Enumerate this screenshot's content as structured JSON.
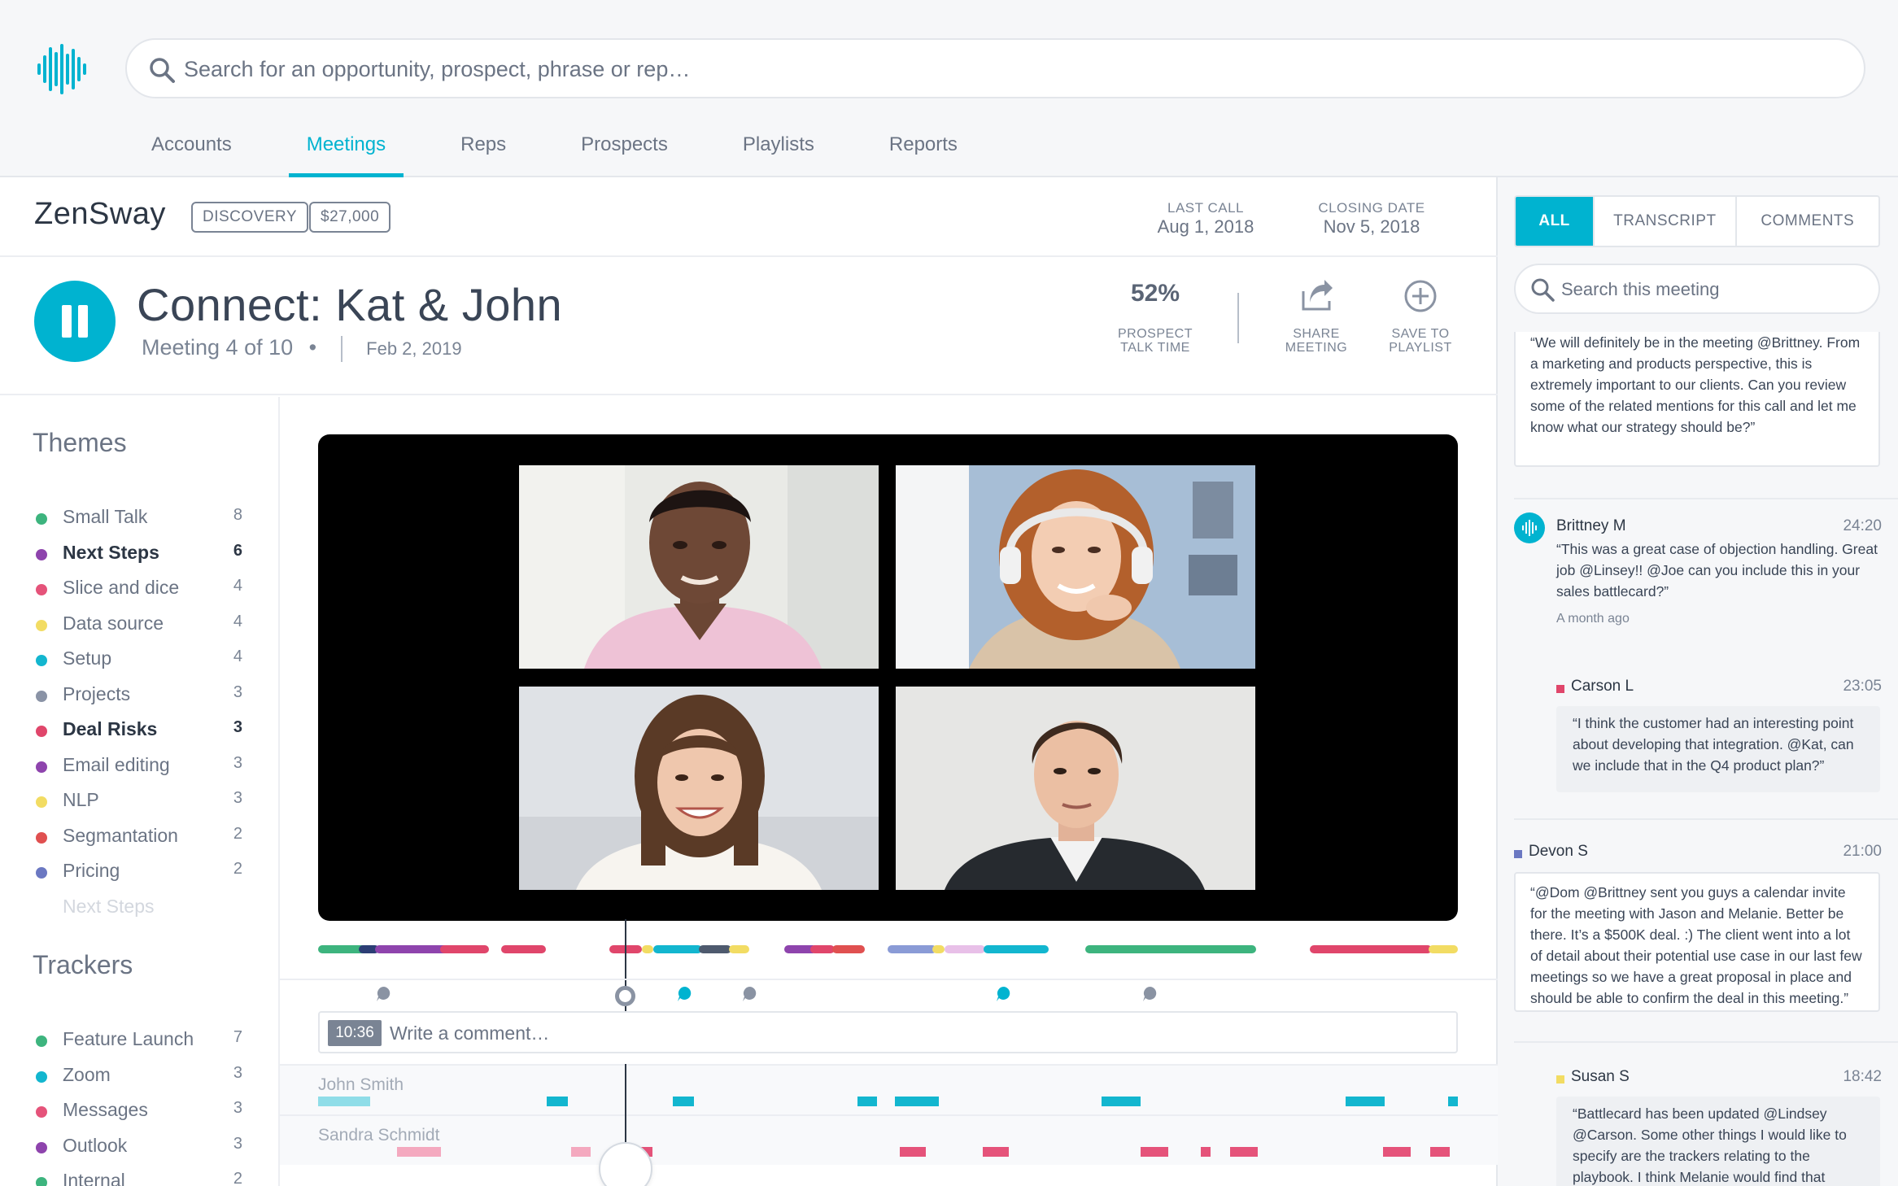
{
  "search": {
    "placeholder": "Search for an opportunity, prospect, phrase or rep…"
  },
  "nav": {
    "tabs": [
      {
        "label": "Accounts"
      },
      {
        "label": "Meetings"
      },
      {
        "label": "Reps"
      },
      {
        "label": "Prospects"
      },
      {
        "label": "Playlists"
      },
      {
        "label": "Reports"
      }
    ],
    "active": "Meetings"
  },
  "deal": {
    "company": "ZenSway",
    "stage": "DISCOVERY",
    "amount": "$27,000",
    "last_call_label": "LAST CALL",
    "last_call": "Aug 1, 2018",
    "closing_label": "CLOSING DATE",
    "closing": "Nov 5, 2018"
  },
  "meeting": {
    "title": "Connect: Kat & John",
    "index": "Meeting 4 of 10",
    "bullet": "•",
    "date": "Feb 2, 2019",
    "talk_time": "52%",
    "talk_time_label_1": "PROSPECT",
    "talk_time_label_2": "TALK TIME",
    "share_label_1": "SHARE",
    "share_label_2": "MEETING",
    "save_label_1": "SAVE TO",
    "save_label_2": "PLAYLIST"
  },
  "themes": {
    "title": "Themes",
    "items": [
      {
        "name": "Small Talk",
        "count": "8",
        "color": "#3db47e"
      },
      {
        "name": "Next Steps",
        "count": "6",
        "color": "#8e44ad"
      },
      {
        "name": "Slice and dice",
        "count": "4",
        "color": "#e5537a"
      },
      {
        "name": "Data source",
        "count": "4",
        "color": "#f2dc63"
      },
      {
        "name": "Setup",
        "count": "4",
        "color": "#13b6cf"
      },
      {
        "name": "Projects",
        "count": "3",
        "color": "#8a93a6"
      },
      {
        "name": "Deal Risks",
        "count": "3",
        "color": "#e0466b"
      },
      {
        "name": "Email editing",
        "count": "3",
        "color": "#8e44ad"
      },
      {
        "name": "NLP",
        "count": "3",
        "color": "#f2dc63"
      },
      {
        "name": "Segmantation",
        "count": "2",
        "color": "#e05050"
      },
      {
        "name": "Pricing",
        "count": "2",
        "color": "#6b78c2"
      },
      {
        "name": "Next Steps",
        "count": "",
        "color": "#e3e6eb"
      }
    ]
  },
  "trackers": {
    "title": "Trackers",
    "items": [
      {
        "name": "Feature Launch",
        "count": "7",
        "color": "#3db47e"
      },
      {
        "name": "Zoom",
        "count": "3",
        "color": "#13b6cf"
      },
      {
        "name": "Messages",
        "count": "3",
        "color": "#e5537a"
      },
      {
        "name": "Outlook",
        "count": "3",
        "color": "#8e44ad"
      },
      {
        "name": "Internal",
        "count": "2",
        "color": "#3db47e"
      }
    ]
  },
  "comment": {
    "time": "10:36",
    "placeholder": "Write a comment…"
  },
  "speakers": [
    {
      "name": "John Smith",
      "color": "#13b6cf"
    },
    {
      "name": "Sandra Schmidt",
      "color": "#e5537a"
    }
  ],
  "right": {
    "tabs": [
      "ALL",
      "TRANSCRIPT",
      "COMMENTS"
    ],
    "active_tab": "ALL",
    "search_placeholder": "Search this meeting",
    "quote0": "“We will definitely be in the meeting @Brittney. From a marketing and products perspective, this is extremely important to our clients. Can you review some of the related mentions for this call and let me know what our strategy should be?”",
    "comments": [
      {
        "name": "Brittney M",
        "time": "24:20",
        "text": "“This was a great case of objection handling. Great job @Linsey!! @Joe can you include this in your sales battlecard?”",
        "ago": "A month ago"
      },
      {
        "name": "Carson L",
        "time": "23:05",
        "text": "“I think the customer had an interesting point about developing that integration. @Kat, can we include that in the Q4 product plan?”",
        "color": "#e0466b"
      },
      {
        "name": "Devon S",
        "time": "21:00",
        "text": "“@Dom @Brittney sent you guys a calendar invite for the meeting with Jason and Melanie. Better be there. It’s a $500K deal. :) The client went into a lot of detail about their potential use case in our last few meetings so we have a great proposal in place and should be able to confirm the deal in this meeting.”",
        "color": "#6b78c2"
      },
      {
        "name": "Susan S",
        "time": "18:42",
        "text": "“Battlecard has been updated @Lindsey @Carson. Some other things I would like to specify are the trackers relating to the playbook. I think Melanie would find that",
        "color": "#f2dc63"
      }
    ]
  },
  "colors": {
    "accent": "#00b3d0",
    "text": "#3a4556",
    "muted": "#6b7484"
  }
}
